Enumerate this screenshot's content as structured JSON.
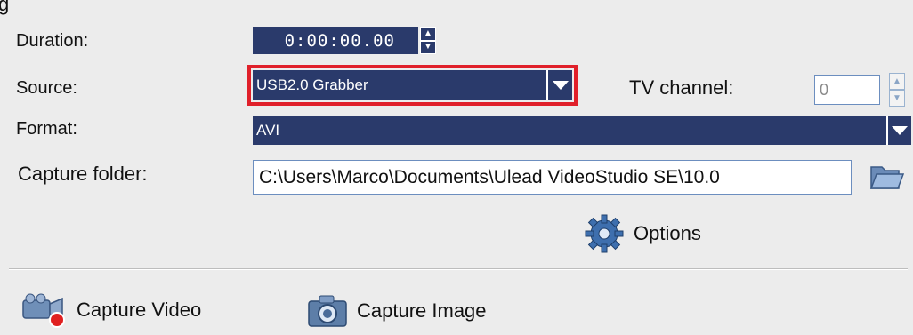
{
  "panel": {
    "title_fragment": "g",
    "duration": {
      "label": "Duration:",
      "value": "0:00:00.00"
    },
    "source": {
      "label": "Source:",
      "value": "USB2.0 Grabber"
    },
    "tv_channel": {
      "label": "TV channel:",
      "value": "0"
    },
    "format": {
      "label": "Format:",
      "value": "AVI"
    },
    "capture_folder": {
      "label": "Capture folder:",
      "value": "C:\\Users\\Marco\\Documents\\Ulead VideoStudio SE\\10.0"
    },
    "options_label": "Options",
    "capture_video_label": "Capture Video",
    "capture_image_label": "Capture Image"
  },
  "colors": {
    "accent": "#2a3a6b",
    "highlight_border": "#e0202a",
    "background": "#ececec"
  },
  "icons": [
    "spin-up-icon",
    "spin-down-icon",
    "dropdown-arrow-icon",
    "folder-icon",
    "gear-icon",
    "video-camera-icon",
    "camera-icon"
  ]
}
